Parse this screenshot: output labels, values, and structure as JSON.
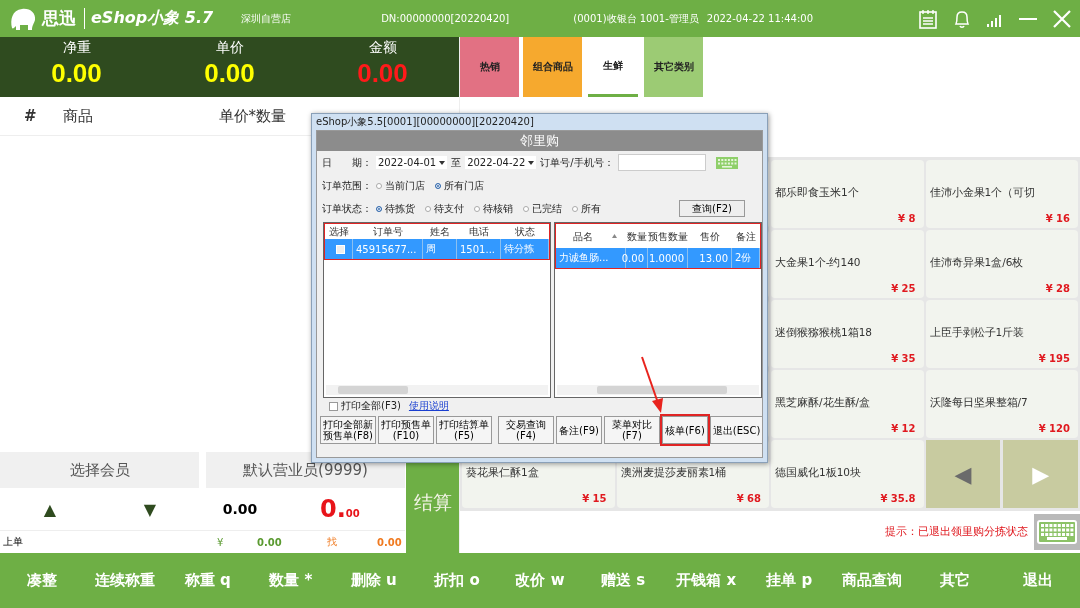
{
  "topbar": {
    "brand": "思迅",
    "product": "eShop小象 5.7",
    "store": "深圳自营店",
    "device": "DN:00000000[20220420]",
    "cashier": "(0001)收银台 1001-管理员",
    "datetime": "2022-04-22 11:44:00"
  },
  "display": [
    {
      "label": "净重",
      "value": "0.00",
      "color": "#ffff00"
    },
    {
      "label": "单价",
      "value": "0.00",
      "color": "#ffff00"
    },
    {
      "label": "金额",
      "value": "0.00",
      "color": "#ff1a1a"
    }
  ],
  "cart": {
    "columns": [
      "#",
      "商品",
      "单价*数量"
    ]
  },
  "member_button": "选择会员",
  "clerk_button": "默认营业员(9999)",
  "totals": {
    "up": "▲",
    "down": "▼",
    "quantity": "0.00",
    "amount_main": "0.",
    "amount_cents": "00",
    "last_order": "上单",
    "currency": "¥",
    "paid": "0.00",
    "change_label": "找",
    "change": "0.00"
  },
  "checkout": "结算",
  "categories": [
    {
      "label": "热销",
      "color": "#e27183",
      "selected": false
    },
    {
      "label": "组合商品",
      "color": "#f6a92e",
      "selected": false
    },
    {
      "label": "生鲜",
      "color": "#ffffff",
      "selected": true
    },
    {
      "label": "其它类别",
      "color": "#9ccb74",
      "selected": false
    }
  ],
  "product_rows": [
    [
      {
        "name": "都乐即食玉米1个",
        "price": "¥ 8"
      },
      {
        "name": "佳沛小金果1个（可切",
        "price": "¥ 16"
      }
    ],
    [
      {
        "name": "大金果1个-约140",
        "price": "¥ 25"
      },
      {
        "name": "佳沛奇异果1盒/6枚",
        "price": "¥ 28"
      }
    ],
    [
      {
        "name": "迷倒猴猕猴桃1箱18",
        "price": "¥ 35"
      },
      {
        "name": "上臣手剥松子1斤装",
        "price": "¥ 195"
      }
    ],
    [
      {
        "name": "黑芝麻酥/花生酥/盒",
        "price": "¥ 12"
      },
      {
        "name": "沃隆每日坚果整箱/7",
        "price": "¥ 120"
      }
    ],
    [
      {
        "name": "葵花果仁酥1盒",
        "price": "¥ 15"
      },
      {
        "name": "澳洲麦提莎麦丽素1桶",
        "price": "¥ 68"
      },
      {
        "name": "德国威化1板10块",
        "price": "¥ 35.8"
      }
    ]
  ],
  "pager": {
    "prev": "◀",
    "next": "▶"
  },
  "hint": "提示：已退出领里购分拣状态",
  "footer": [
    "凑整",
    "连续称重",
    "称重 q",
    "数量 *",
    "删除 u",
    "折扣 o",
    "改价 w",
    "赠送 s",
    "开钱箱 x",
    "挂单 p",
    "商品查询",
    "其它",
    "退出"
  ],
  "dialog": {
    "window_title": "eShop小象5.5[0001][00000000][20220420]",
    "title": "邻里购",
    "date_label": "日　　期：",
    "date_from": "2022-04-01",
    "to_label": "至",
    "date_to": "2022-04-22",
    "search_label": "订单号/手机号：",
    "scope_label": "订单范围：",
    "scope_options": [
      {
        "label": "当前门店",
        "selected": false
      },
      {
        "label": "所有门店",
        "selected": true
      }
    ],
    "status_label": "订单状态：",
    "status_options": [
      {
        "label": "待拣货",
        "selected": true
      },
      {
        "label": "待支付",
        "selected": false
      },
      {
        "label": "待核销",
        "selected": false
      },
      {
        "label": "已完结",
        "selected": false
      },
      {
        "label": "所有",
        "selected": false
      }
    ],
    "query_button": "查询(F2)",
    "orders": {
      "highlighted": true,
      "columns": [
        "选择",
        "订单号",
        "姓名",
        "电话",
        "状态"
      ],
      "rows": [
        {
          "checked": false,
          "selected": true,
          "cells": [
            "",
            "45915677...",
            "周",
            "1501...",
            "待分拣"
          ]
        }
      ]
    },
    "items": {
      "highlighted": true,
      "columns": [
        "品名",
        "数量",
        "预售数量",
        "售价",
        "备注"
      ],
      "rows": [
        {
          "selected": true,
          "cells": [
            "力诚鱼肠...",
            "0.00",
            "1.0000",
            "13.00",
            "2份"
          ]
        }
      ]
    },
    "print_all": {
      "label": "打印全部(F3)",
      "checked": false
    },
    "help_link": "使用说明",
    "buttons": [
      {
        "label": "打印全部新预售单(F8)",
        "highlighted": false
      },
      {
        "label": "打印预售单(F10)",
        "highlighted": false
      },
      {
        "label": "打印结算单(F5)",
        "highlighted": false
      },
      {
        "label": "交易查询(F4)",
        "highlighted": false
      },
      {
        "label": "备注(F9)",
        "highlighted": false
      },
      {
        "label": "菜单对比(F7)",
        "highlighted": false
      },
      {
        "label": "核单(F6)",
        "highlighted": true
      },
      {
        "label": "退出(ESC)",
        "highlighted": false
      }
    ],
    "callout_arrow": true
  }
}
